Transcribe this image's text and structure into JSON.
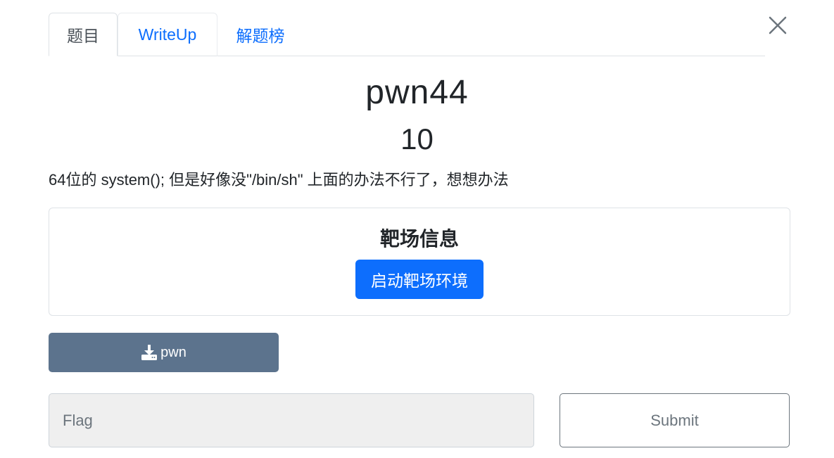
{
  "tabs": [
    {
      "label": "题目",
      "active": true
    },
    {
      "label": "WriteUp",
      "active": false
    },
    {
      "label": "解题榜",
      "active": false
    }
  ],
  "challenge": {
    "title": "pwn44",
    "points": "10",
    "description": "64位的 system(); 但是好像没\"/bin/sh\" 上面的办法不行了，想想办法"
  },
  "target": {
    "heading": "靶场信息",
    "start_button": "启动靶场环境"
  },
  "download": {
    "label": "pwn",
    "icon": "download-icon"
  },
  "flag": {
    "placeholder": "Flag",
    "value": ""
  },
  "submit_label": "Submit",
  "colors": {
    "primary": "#0d6efd",
    "download_bg": "#5c738d",
    "secondary": "#6c757d"
  }
}
